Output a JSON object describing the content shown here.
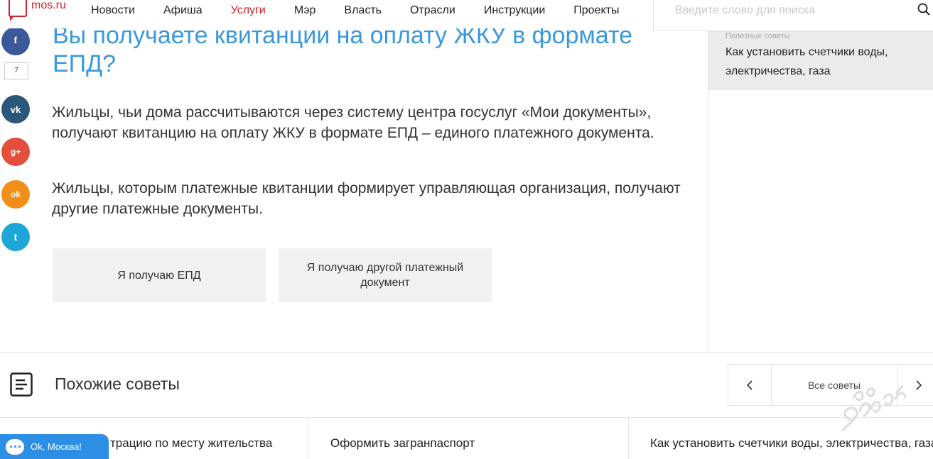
{
  "header": {
    "logo_text": "mos.ru",
    "nav": [
      {
        "label": "Новости"
      },
      {
        "label": "Афиша"
      },
      {
        "label": "Услуги",
        "active": true
      },
      {
        "label": "Мэр"
      },
      {
        "label": "Власть"
      },
      {
        "label": "Отрасли"
      },
      {
        "label": "Инструкции"
      },
      {
        "label": "Проекты"
      }
    ],
    "search_placeholder": "Введите слово для поиска"
  },
  "social": {
    "share_count": "7",
    "buttons": [
      {
        "glyph": "f",
        "name": "facebook-icon",
        "color": "#3b5998"
      },
      {
        "glyph": "vk",
        "name": "vk-icon",
        "color": "#2b587a"
      },
      {
        "glyph": "g+",
        "name": "google-plus-icon",
        "color": "#e44f3b"
      },
      {
        "glyph": "ok",
        "name": "odnoklassniki-icon",
        "color": "#f28f1b"
      },
      {
        "glyph": "t",
        "name": "twitter-icon",
        "color": "#1ea6d8"
      }
    ]
  },
  "article": {
    "title": "Вы получаете квитанции на оплату ЖКУ в формате ЕПД?",
    "paragraphs": [
      "Жильцы, чьи дома рассчитываются через систему центра госуслуг «Мои документы», получают квитанцию на оплату ЖКУ в формате ЕПД – единого платежного документа.",
      "Жильцы, которым платежные квитанции формирует управляющая организация, получают другие платежные документы."
    ],
    "choice_buttons": [
      "Я получаю ЕПД",
      "Я получаю другой платежный документ"
    ]
  },
  "sidebar": {
    "cut_label": "Полезные советы",
    "related": "Как установить счетчики воды, электричества, газа"
  },
  "similar": {
    "title": "Похожие советы",
    "all_label": "Все советы",
    "items": [
      "трацию по месту жительства",
      "Оформить загранпаспорт",
      "Как установить счетчики воды, электричества, газа"
    ]
  },
  "chat": {
    "label": "Ok, Москва!"
  },
  "colors": {
    "brand_red": "#cc2229",
    "title_blue": "#3b99db",
    "chat_blue": "#2d8ee6"
  }
}
